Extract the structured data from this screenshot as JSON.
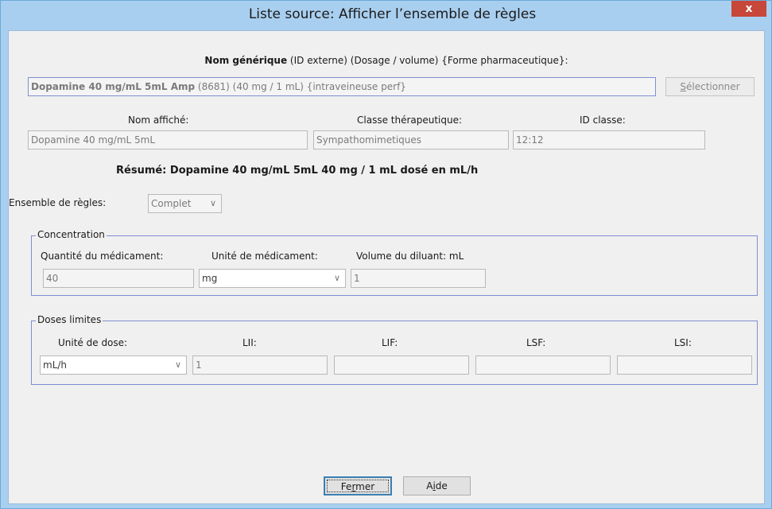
{
  "window": {
    "title": "Liste source:  Afficher l’ensemble de règles",
    "close_label": "x"
  },
  "generic_name": {
    "header_bold": "Nom générique",
    "header_rest": " (ID externe) (Dosage / volume) {Forme pharmaceutique}:",
    "value_bold": "Dopamine 40 mg/mL 5mL Amp",
    "value_rest": " (8681) (40 mg / 1 mL) {intraveineuse perf}",
    "select_before": "",
    "select_underlined": "S",
    "select_after": "électionner"
  },
  "display": {
    "name_label": "Nom affiché:",
    "name_value": "Dopamine 40 mg/mL  5mL",
    "class_label": "Classe thérapeutique:",
    "class_value": "Sympathomimetiques",
    "id_label": "ID classe:",
    "id_value": "12:12"
  },
  "summary": "Résumé: Dopamine 40 mg/mL  5mL 40 mg / 1 mL dosé en mL/h",
  "rules": {
    "label": "Ensemble de règles:",
    "value": "Complet"
  },
  "concentration": {
    "legend": "Concentration",
    "qty_label": "Quantité du médicament:",
    "qty_value": "40",
    "unit_label": "Unité de médicament:",
    "unit_value": "mg",
    "diluent_label": "Volume du diluant: mL",
    "diluent_value": "1"
  },
  "limits": {
    "legend": "Doses limites",
    "dose_unit_label": "Unité de dose:",
    "dose_unit_value": "mL/h",
    "dose_value": "1",
    "lii_label": "LII:",
    "lif_label": "LIF:",
    "lsf_label": "LSF:",
    "lsi_label": "LSI:",
    "lif_value": "",
    "lsf_value": "",
    "lsi_value": ""
  },
  "buttons": {
    "close_before": "Fe",
    "close_underlined": "r",
    "close_after": "mer",
    "help_before": "A",
    "help_underlined": "i",
    "help_after": "de"
  },
  "colors": {
    "titlebar": "#a9cff0",
    "content_bg": "#f0f0f0",
    "group_border": "#7f8fd0",
    "close_button": "#c7473a",
    "default_button_border": "#3c7fb1"
  }
}
